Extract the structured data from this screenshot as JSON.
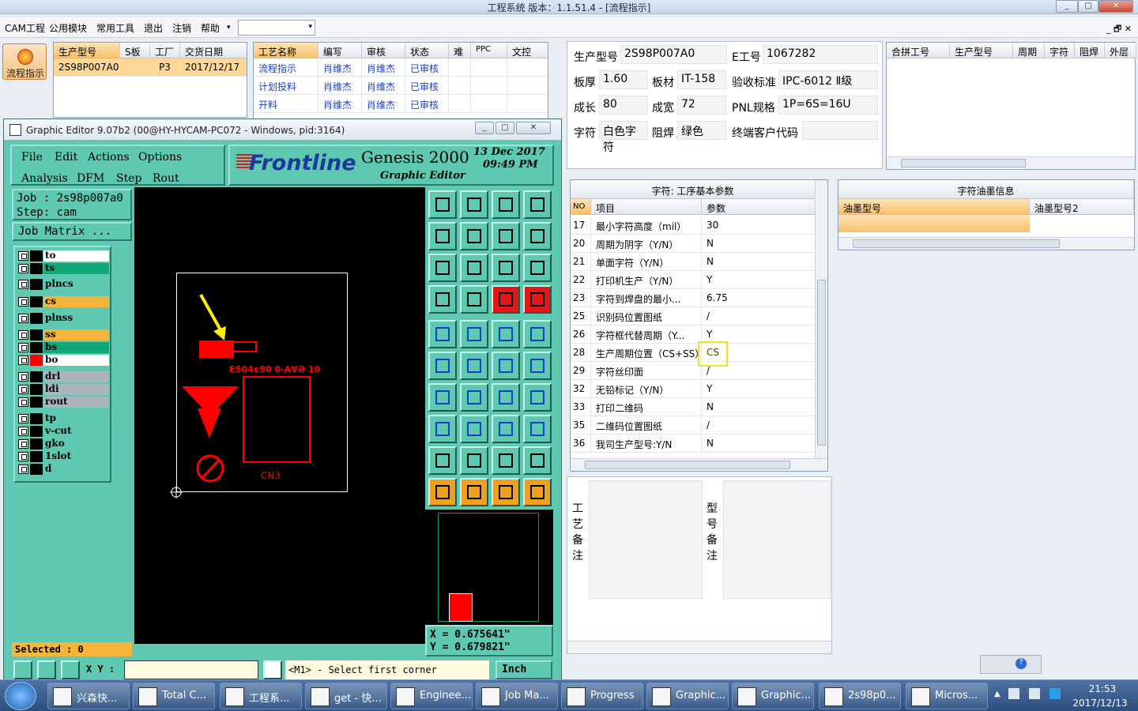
{
  "window": {
    "title": "工程系统  版本：1.1.51.4 - [流程指示]"
  },
  "menubar": {
    "items": [
      "CAM工程",
      "公用模块",
      "常用工具",
      "退出",
      "注销",
      "帮助"
    ],
    "right": "_ 🗗 ✕"
  },
  "nav": {
    "flow_button": "流程指示"
  },
  "jobs": {
    "headers": [
      "生产型号",
      "S板",
      "工厂",
      "交货日期"
    ],
    "rows": [
      [
        "2S98P007A0",
        "",
        "P3",
        "2017/12/17"
      ]
    ]
  },
  "process": {
    "headers": [
      "工艺名称",
      "编写",
      "审核",
      "状态",
      "难",
      "PPC",
      "文控"
    ],
    "rows": [
      [
        "流程指示",
        "肖维杰",
        "肖维杰",
        "已审核"
      ],
      [
        "计划投料",
        "肖维杰",
        "肖维杰",
        "已审核"
      ],
      [
        "开料",
        "肖维杰",
        "肖维杰",
        "已审核"
      ]
    ]
  },
  "editor": {
    "title": "Graphic Editor 9.07b2 (00@HY-HYCAM-PC072 - Windows, pid:3164)",
    "menu": [
      "File",
      "Edit",
      "Actions",
      "Options",
      "Analysis",
      "DFM",
      "Step",
      "Rout"
    ],
    "brand": "Frontline",
    "product": "Genesis 2000",
    "product_sub": "Graphic Editor",
    "date": "13  Dec  2017",
    "time": "09:49  PM",
    "job": "Job  : 2s98p007a0",
    "step": "Step: cam",
    "job_matrix": "Job Matrix ...",
    "layers": [
      {
        "name": "to",
        "color": "#000000",
        "bg": "#ffffff"
      },
      {
        "name": "ts",
        "color": "#000000",
        "bg": "#10a878"
      },
      {
        "name": "plncs",
        "color": "#000000",
        "bg": "#5ec8b0"
      },
      {
        "name": "cs",
        "color": "#000000",
        "bg": "#f5b53a"
      },
      {
        "name": "plnss",
        "color": "#000000",
        "bg": "#5ec8b0"
      },
      {
        "name": "ss",
        "color": "#000000",
        "bg": "#f5b53a"
      },
      {
        "name": "bs",
        "color": "#000000",
        "bg": "#10a878"
      },
      {
        "name": "bo",
        "color": "#ff0000",
        "bg": "#ffffff"
      },
      {
        "name": "drl",
        "color": "#000000",
        "bg": "#a9b4be"
      },
      {
        "name": "ldi",
        "color": "#000000",
        "bg": "#a9b4be"
      },
      {
        "name": "rout",
        "color": "#000000",
        "bg": "#a9b4be"
      },
      {
        "name": "tp",
        "color": "#000000",
        "bg": "#5ec8b0"
      },
      {
        "name": "v-cut",
        "color": "#000000",
        "bg": "#5ec8b0"
      },
      {
        "name": "gko",
        "color": "#000000",
        "bg": "#5ec8b0"
      },
      {
        "name": "1slot",
        "color": "#000000",
        "bg": "#5ec8b0"
      },
      {
        "name": "d",
        "color": "#000000",
        "bg": "#5ec8b0"
      }
    ],
    "selected": "Selected : 0",
    "xy_label": "X Y :",
    "prompt": "<M1> - Select first corner",
    "units": "Inch",
    "coord_x": "X = 0.675641\"",
    "coord_y": "Y = 0.679821\"",
    "board_text": "CN3",
    "silk_text": "ES04¢90 0-A∀Ə 10"
  },
  "info": {
    "labels": {
      "model": "生产型号",
      "eno": "E工号",
      "thick": "板厚",
      "mat": "板材",
      "std": "验收标准",
      "len": "成长",
      "wid": "成宽",
      "pnl": "PNL规格",
      "char": "字符",
      "mask": "阻焊",
      "cust": "终端客户代码"
    },
    "values": {
      "model": "2S98P007A0",
      "eno": "1067282",
      "thick": "1.60",
      "mat": "IT-158",
      "std": "IPC-6012 Ⅱ级",
      "len": "80",
      "wid": "72",
      "pnl": "1P=6S=16U",
      "char": "白色字符",
      "mask": "绿色",
      "cust": ""
    }
  },
  "merge": {
    "headers": [
      "合拼工号",
      "生产型号",
      "周期",
      "字符",
      "阻焊",
      "外层"
    ]
  },
  "params": {
    "title": "字符: 工序基本参数",
    "headers": [
      "NO",
      "项目",
      "参数"
    ],
    "rows": [
      [
        "17",
        "最小字符高度（mil）",
        "30"
      ],
      [
        "20",
        "周期为阴字（Y/N）",
        "N"
      ],
      [
        "21",
        "单面字符（Y/N）",
        "N"
      ],
      [
        "22",
        "打印机生产（Y/N）",
        "Y"
      ],
      [
        "23",
        "字符到焊盘的最小...",
        "6.75"
      ],
      [
        "25",
        "识别码位置图纸",
        "/"
      ],
      [
        "26",
        "字符框代替周期（Y...",
        "Y"
      ],
      [
        "28",
        "生产周期位置（CS+SS）",
        "CS"
      ],
      [
        "29",
        "字符丝印面",
        "/"
      ],
      [
        "32",
        "无铅标记（Y/N）",
        "Y"
      ],
      [
        "33",
        "打印二维码",
        "N"
      ],
      [
        "35",
        "二维码位置图纸",
        "/"
      ],
      [
        "36",
        "我司生产型号:Y/N",
        "N"
      ]
    ]
  },
  "ink": {
    "title": "字符油墨信息",
    "headers": [
      "油墨型号",
      "油墨型号2"
    ]
  },
  "notes": {
    "process": "工艺备注",
    "model": "型号备注"
  },
  "taskbar": {
    "items": [
      "兴森快...",
      "Total C...",
      "工程系...",
      "get - 快...",
      "Enginee...",
      "Job Ma...",
      "Progress",
      "Graphic...",
      "Graphic...",
      "2s98p0...",
      "Micros..."
    ],
    "time": "21:53",
    "date": "2017/12/13"
  },
  "colors": {
    "accent": "#f5b53a",
    "editor_bg": "#5ec8b0",
    "board": "#ff1010"
  }
}
